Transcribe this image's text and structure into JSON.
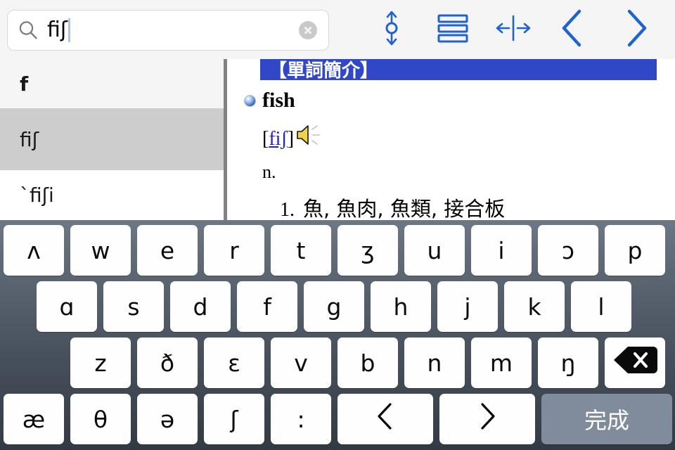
{
  "search": {
    "value": "fiʃ",
    "placeholder": "",
    "icon": "search-icon",
    "clear_icon": "clear-circle-icon"
  },
  "toolbar": {
    "items": [
      {
        "name": "vertical-resize-icon",
        "label": "↕"
      },
      {
        "name": "list-view-icon",
        "label": "☰"
      },
      {
        "name": "horizontal-split-icon",
        "label": "↔"
      },
      {
        "name": "back-chevron-icon",
        "label": "‹"
      },
      {
        "name": "forward-chevron-icon",
        "label": "›"
      }
    ],
    "accent_color": "#1f63d0"
  },
  "wordlist": {
    "items": [
      {
        "label": "f",
        "selected": false
      },
      {
        "label": "fiʃ",
        "selected": true
      },
      {
        "label": "`fiʃi",
        "selected": false
      }
    ],
    "selected_bg": "#cdcdcd"
  },
  "entry": {
    "banner": "【單詞簡介】",
    "banner_color": "#3048c8",
    "word": "fish",
    "pronunciation_open": "[",
    "pronunciation": "fiʃ",
    "pronunciation_close": "]",
    "speaker_icon": "speaker-icon",
    "part_of_speech": "n.",
    "senses": [
      {
        "num": "1.",
        "text": "魚, 魚肉, 魚類, 接合板"
      }
    ]
  },
  "keyboard": {
    "row1": [
      "ʌ",
      "w",
      "e",
      "r",
      "t",
      "ʒ",
      "u",
      "i",
      "ɔ",
      "p"
    ],
    "row2": [
      "ɑ",
      "s",
      "d",
      "f",
      "g",
      "h",
      "j",
      "k",
      "l"
    ],
    "row3": [
      "z",
      "ð",
      "ɛ",
      "v",
      "b",
      "n",
      "m",
      "ŋ"
    ],
    "backspace_icon": "backspace-icon",
    "row4": [
      "æ",
      "θ",
      "ə",
      "ʃ",
      ":"
    ],
    "prev_label": "‹",
    "next_label": "›",
    "done_label": "完成"
  }
}
